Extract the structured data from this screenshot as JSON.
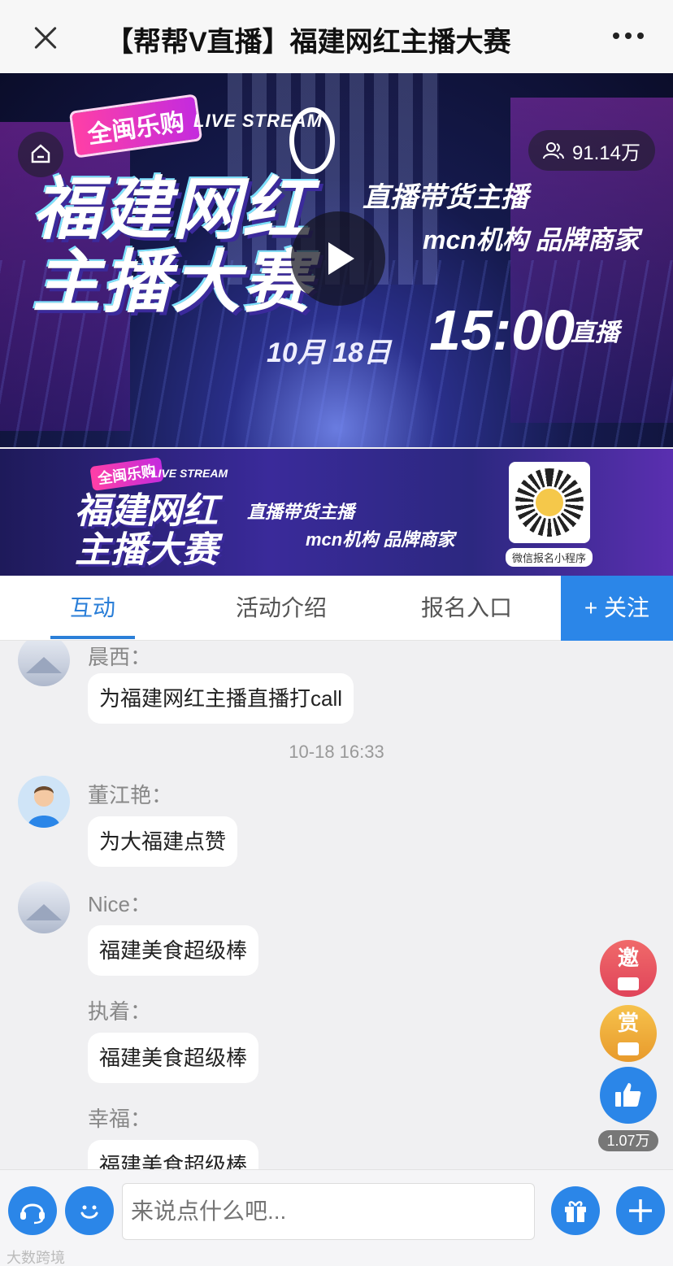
{
  "header": {
    "title": "【帮帮V直播】福建网红主播大赛"
  },
  "video": {
    "promo_tag": "全闽乐购",
    "live_stream_label": "LIVE STREAM",
    "title_line1": "福建网红",
    "title_line2": "主播大赛",
    "slogan_line1": "直播带货主播",
    "slogan_line2": "mcn机构  品牌商家",
    "date": "10月 18日",
    "time": "15:00",
    "live_word": "直播",
    "viewer_count": "91.14万"
  },
  "banner": {
    "promo_tag": "全闽乐购",
    "live_stream_label": "LIVE STREAM",
    "title_line1": "福建网红",
    "title_line2": "主播大赛",
    "slogan_line1": "直播带货主播",
    "slogan_line2": "mcn机构  品牌商家",
    "qr_caption": "微信报名小程序"
  },
  "tabs": {
    "interact": "互动",
    "intro": "活动介绍",
    "signup": "报名入口",
    "follow": "+ 关注"
  },
  "chat": {
    "messages": [
      {
        "user": "晨西：",
        "text": "为福建网红主播直播打call"
      },
      {
        "user": "董江艳：",
        "text": "为大福建点赞"
      },
      {
        "user": "Nice：",
        "text": "福建美食超级棒"
      },
      {
        "user": "执着：",
        "text": "福建美食超级棒"
      },
      {
        "user": "幸福：",
        "text": "福建美食超级棒"
      }
    ],
    "timestamp": "10-18 16:33"
  },
  "side_buttons": {
    "invite": "邀",
    "reward": "赏",
    "like_count": "1.07万"
  },
  "input": {
    "placeholder": "来说点什么吧..."
  },
  "watermark": "大数跨境",
  "colors": {
    "accent": "#2b86e8",
    "invite": "#e0445a",
    "reward": "#f0a83a"
  }
}
